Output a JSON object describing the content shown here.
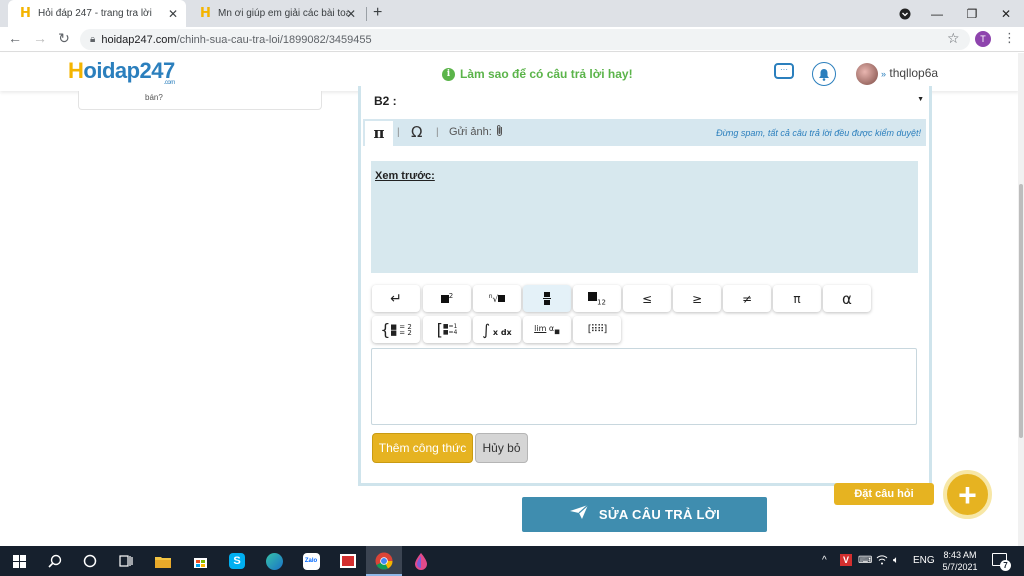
{
  "browser": {
    "tabs": [
      {
        "title": "Hỏi đáp 247 - trang tra lời",
        "active": true
      },
      {
        "title": "Mn ơi giúp em giải các bài toán",
        "active": false
      }
    ],
    "url_domain": "hoidap247.com",
    "url_path": "/chinh-sua-cau-tra-loi/1899082/3459455",
    "profile_initial": "T"
  },
  "site": {
    "logo": "Hoidap247",
    "logo_suffix": ".com",
    "tip": "Làm sao để có câu trả lời hay!",
    "username": "thqllop6a"
  },
  "left_card_text": "bán?",
  "editor": {
    "section_label": "B2 :",
    "toolbar": {
      "pi_tab": "π",
      "omega_tab": "Ω",
      "upload_label": "Gửi ảnh:",
      "warning": "Đừng spam, tất cả câu trả lời đều được kiểm duyệt!"
    },
    "preview_title": "Xem trước:",
    "math_buttons": [
      "↵",
      "x²",
      "√",
      "frac",
      "x₁₂",
      "≤",
      "≥",
      "≠",
      "π",
      "α"
    ],
    "math_buttons_row2": [
      "system",
      "cases",
      "integral",
      "limit",
      "matrix"
    ],
    "limit_label": "lim",
    "add_formula": "Thêm công thức",
    "cancel": "Hủy bỏ"
  },
  "submit_label": "SỬA CÂU TRẢ LỜI",
  "ask_question": "Đặt câu hỏi",
  "taskbar": {
    "lang": "ENG",
    "time": "8:43 AM",
    "date": "5/7/2021",
    "notifications": "7"
  },
  "colors": {
    "brand_blue": "#2b7fbd",
    "brand_yellow": "#e6b321",
    "panel_blue": "#d7e8ee",
    "submit_blue": "#3f8daf",
    "tip_green": "#5bb44a"
  }
}
